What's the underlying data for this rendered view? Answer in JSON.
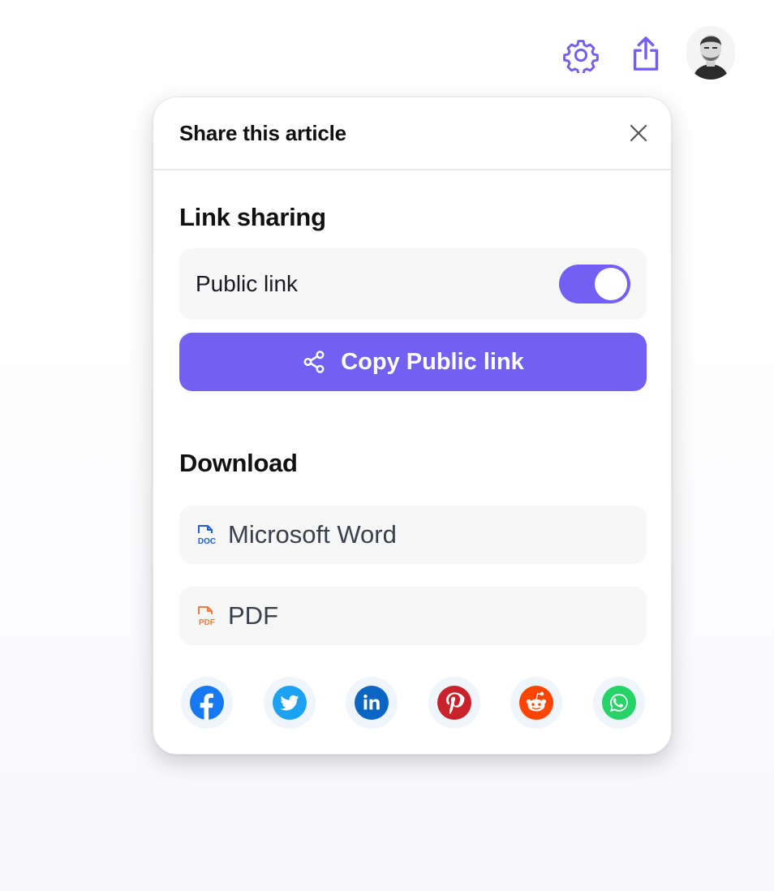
{
  "topbar": {
    "icons": [
      "gear-icon",
      "share-upload-icon"
    ],
    "accent": "#7360f2"
  },
  "panel": {
    "title": "Share this article",
    "link_sharing": {
      "title": "Link sharing",
      "public_link_label": "Public link",
      "public_link_enabled": true,
      "copy_button_label": "Copy Public link"
    },
    "download": {
      "title": "Download",
      "options": [
        {
          "label": "Microsoft Word",
          "icon": "doc-file-icon",
          "icon_text": "DOC",
          "color": "#1f5ed6"
        },
        {
          "label": "PDF",
          "icon": "pdf-file-icon",
          "icon_text": "PDF",
          "color": "#f07c3c"
        }
      ]
    },
    "social": [
      {
        "name": "facebook",
        "color": "#1877f2"
      },
      {
        "name": "twitter",
        "color": "#1da1f2"
      },
      {
        "name": "linkedin",
        "color": "#0a66c2"
      },
      {
        "name": "pinterest",
        "color": "#c8232c"
      },
      {
        "name": "reddit",
        "color": "#ff4500"
      },
      {
        "name": "whatsapp",
        "color": "#25d366"
      }
    ]
  }
}
